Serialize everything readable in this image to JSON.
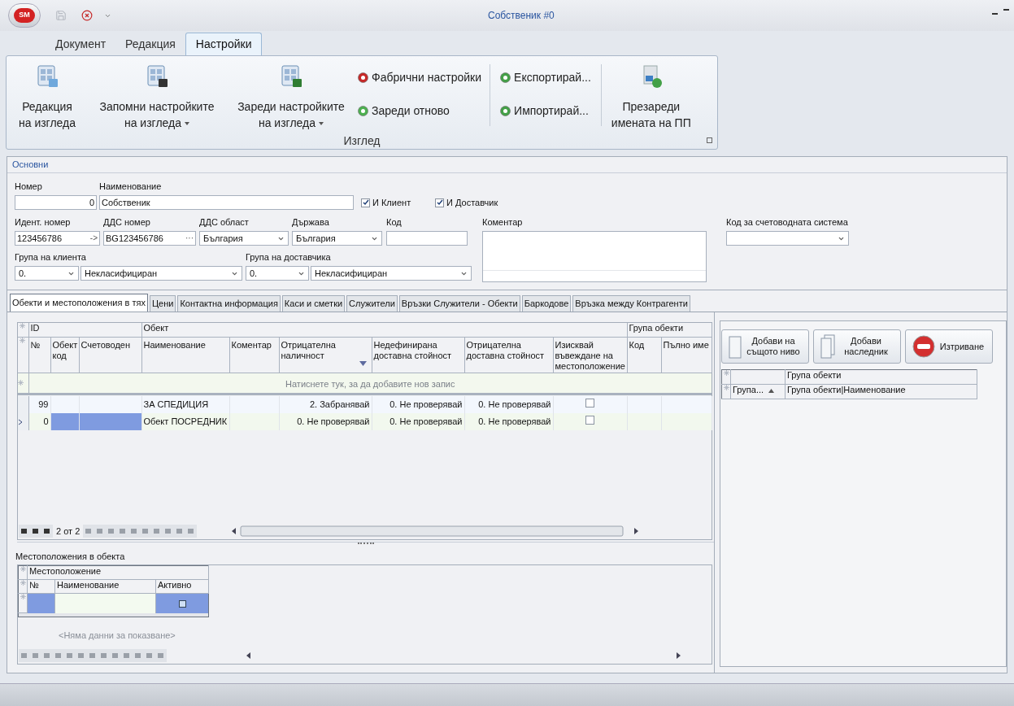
{
  "window": {
    "title": "Собственик #0",
    "logo": "SM"
  },
  "ribbon_tabs": [
    {
      "label": "Документ",
      "selected": false
    },
    {
      "label": "Редакция",
      "selected": false
    },
    {
      "label": "Настройки",
      "selected": true
    }
  ],
  "ribbon": {
    "group_label": "Изглед",
    "large_buttons": [
      {
        "label": "Редакция\nна изгледа",
        "dropdown": false,
        "kind": "edit"
      },
      {
        "label": "Запомни настройките\nна изгледа",
        "dropdown": true,
        "kind": "save"
      },
      {
        "label": "Зареди настройките\nна изгледа",
        "dropdown": true,
        "kind": "load"
      }
    ],
    "small_buttons": [
      {
        "label": "Фабрични настройки",
        "kind": "reset"
      },
      {
        "label": "Зареди отново",
        "kind": "reload"
      },
      {
        "label": "Експортирай...",
        "kind": "export"
      },
      {
        "label": "Импортирай...",
        "kind": "import"
      }
    ],
    "reload_names": {
      "label": "Презареди\nимената на ПП"
    }
  },
  "form": {
    "section": "Основни",
    "number": {
      "label": "Номер",
      "value": "0"
    },
    "name": {
      "label": "Наименование",
      "value": "Собственик"
    },
    "flags": [
      {
        "label": "И Клиент",
        "checked": true
      },
      {
        "label": "И Доставчик",
        "checked": true
      }
    ],
    "id_number": {
      "label": "Идент. номер",
      "value": "123456786",
      "button": "->"
    },
    "vat_number": {
      "label": "ДДС номер",
      "value": "BG123456786",
      "button": "···"
    },
    "vat_area": {
      "label": "ДДС област",
      "value": "България"
    },
    "country": {
      "label": "Държава",
      "value": "България"
    },
    "code": {
      "label": "Код"
    },
    "comment": {
      "label": "Коментар"
    },
    "accounting_code": {
      "label": "Код за счетоводната система"
    },
    "client_group": {
      "label": "Група на клиента",
      "code": "0.",
      "value": "Некласифициран"
    },
    "supplier_group": {
      "label": "Група на доставчика",
      "code": "0.",
      "value": "Некласифициран"
    }
  },
  "detail_tabs": [
    {
      "label": "Обекти и местоположения в тях",
      "selected": true
    },
    {
      "label": "Цени",
      "selected": false
    },
    {
      "label": "Контактна информация",
      "selected": false
    },
    {
      "label": "Каси и сметки",
      "selected": false
    },
    {
      "label": "Служители",
      "selected": false
    },
    {
      "label": "Връзки Служители - Обекти",
      "selected": false
    },
    {
      "label": "Баркодове",
      "selected": false
    },
    {
      "label": "Връзка между Контрагенти",
      "selected": false
    }
  ],
  "objects_grid": {
    "bands": [
      "ID",
      "Обект",
      "Група обекти"
    ],
    "columns": [
      "№",
      "Обект код",
      "Счетоводен",
      "Наименование",
      "Коментар",
      "Отрицателна наличност",
      "Недефинирана доставна стойност",
      "Отрицателна доставна стойност",
      "Изисквай въвеждане на местоположение",
      "Код",
      "Пълно име"
    ],
    "new_row_hint": "Натиснете тук, за да добавите нов запис",
    "rows": [
      {
        "no": "99",
        "name": "ЗА СПЕДИЦИЯ",
        "negative_stock": "2. Забранявай",
        "undefined_cost": "0. Не проверявай",
        "negative_cost": "0. Не проверявай",
        "require_location": false,
        "selected": false
      },
      {
        "no": "0",
        "name": "Обект ПОСРЕДНИК",
        "negative_stock": "0. Не проверявай",
        "undefined_cost": "0. Не проверявай",
        "negative_cost": "0. Не проверявай",
        "require_location": false,
        "selected": true
      }
    ],
    "position": "2 от 2"
  },
  "locations": {
    "label": "Местоположения в обекта",
    "band": "Местоположение",
    "columns": [
      "№",
      "Наименование",
      "Активно"
    ],
    "empty_text": "<Няма данни за показване>"
  },
  "groups_panel": {
    "buttons": [
      {
        "label": "Добави на\nсъщото ниво",
        "kind": "page"
      },
      {
        "label": "Добави\nнаследник",
        "kind": "pages"
      },
      {
        "label": "Изтриване",
        "kind": "delete"
      }
    ],
    "band": "Група обекти",
    "columns": [
      "Група...",
      "Група обекти|Наименование"
    ]
  }
}
